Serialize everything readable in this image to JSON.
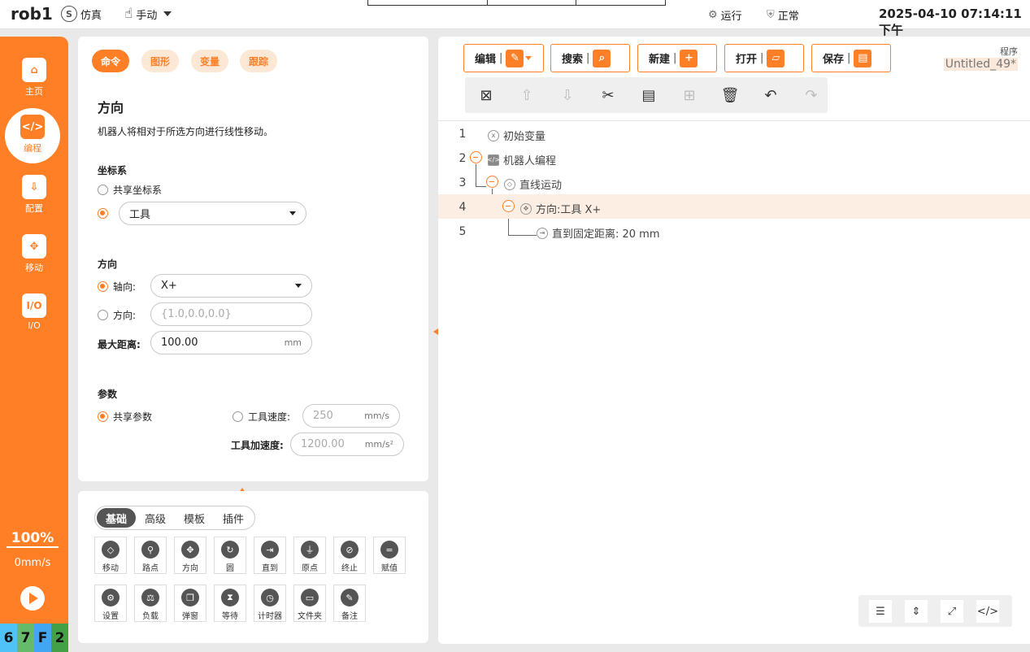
{
  "topbar": {
    "robot_name": "rob1",
    "mode_sim": "仿真",
    "mode_manual": "手动",
    "status_run": "运行",
    "status_ok": "正常",
    "datetime": "2025-04-10 07:14:11 下午"
  },
  "sidebar": {
    "items": [
      {
        "label": "主页",
        "icon": "home-icon"
      },
      {
        "label": "编程",
        "icon": "code-icon"
      },
      {
        "label": "配置",
        "icon": "config-icon"
      },
      {
        "label": "移动",
        "icon": "move-icon"
      },
      {
        "label": "I/O",
        "icon": "io-icon"
      }
    ],
    "speed_percent": "100%",
    "speed_mm": "0mm/s",
    "hex": [
      "6",
      "7",
      "F",
      "2"
    ],
    "hex_colors": [
      "#4fc3f7",
      "#66bb6a",
      "#42a5f5",
      "#43a047"
    ]
  },
  "left_panel": {
    "tabs": [
      "命令",
      "图形",
      "变量",
      "跟踪"
    ],
    "title": "方向",
    "description": "机器人将相对于所选方向进行线性移动。",
    "coord_section": "坐标系",
    "coord_shared": "共享坐标系",
    "coord_tool_value": "工具",
    "dir_section": "方向",
    "axis_label": "轴向:",
    "axis_value": "X+",
    "direction_label": "方向:",
    "direction_placeholder": "{1.0,0.0,0.0}",
    "max_dist_label": "最大距离:",
    "max_dist_value": "100.00",
    "max_dist_unit": "mm",
    "params_section": "参数",
    "shared_params": "共享参数",
    "tool_speed_label": "工具速度:",
    "tool_speed_value": "250",
    "tool_speed_unit": "mm/s",
    "tool_acc_label": "工具加速度:",
    "tool_acc_value": "1200.00",
    "tool_acc_unit": "mm/s²"
  },
  "palette": {
    "tabs": [
      "基础",
      "高级",
      "模板",
      "插件"
    ],
    "tools_row1": [
      {
        "label": "移动",
        "icon": "move-icon",
        "glyph": "◇"
      },
      {
        "label": "路点",
        "icon": "waypoint-icon",
        "glyph": "⚲"
      },
      {
        "label": "方向",
        "icon": "direction-icon",
        "glyph": "✥"
      },
      {
        "label": "圆",
        "icon": "circle-icon",
        "glyph": "↻"
      },
      {
        "label": "直到",
        "icon": "until-icon",
        "glyph": "⇥"
      },
      {
        "label": "原点",
        "icon": "origin-icon",
        "glyph": "⏚"
      },
      {
        "label": "终止",
        "icon": "stop-icon",
        "glyph": "⊘"
      },
      {
        "label": "赋值",
        "icon": "assign-icon",
        "glyph": "="
      }
    ],
    "tools_row2": [
      {
        "label": "设置",
        "icon": "settings-icon",
        "glyph": "⚙"
      },
      {
        "label": "负载",
        "icon": "payload-icon",
        "glyph": "⚖"
      },
      {
        "label": "弹窗",
        "icon": "popup-icon",
        "glyph": "❐"
      },
      {
        "label": "等待",
        "icon": "wait-icon",
        "glyph": "⧗"
      },
      {
        "label": "计时器",
        "icon": "timer-icon",
        "glyph": "◷"
      },
      {
        "label": "文件夹",
        "icon": "folder-icon",
        "glyph": "▭"
      },
      {
        "label": "备注",
        "icon": "note-icon",
        "glyph": "✎"
      }
    ]
  },
  "toolbar": {
    "edit": "编辑",
    "search": "搜索",
    "new": "新建",
    "open": "打开",
    "save": "保存",
    "program_label": "程序",
    "program_name": "Untitled_49*"
  },
  "tree": [
    {
      "line": "1",
      "text": "初始变量"
    },
    {
      "line": "2",
      "text": "机器人编程"
    },
    {
      "line": "3",
      "text": "直线运动"
    },
    {
      "line": "4",
      "text": "方向:工具 X+"
    },
    {
      "line": "5",
      "text": "直到固定距离: 20 mm"
    }
  ],
  "colors": {
    "accent": "#ff7f27"
  }
}
